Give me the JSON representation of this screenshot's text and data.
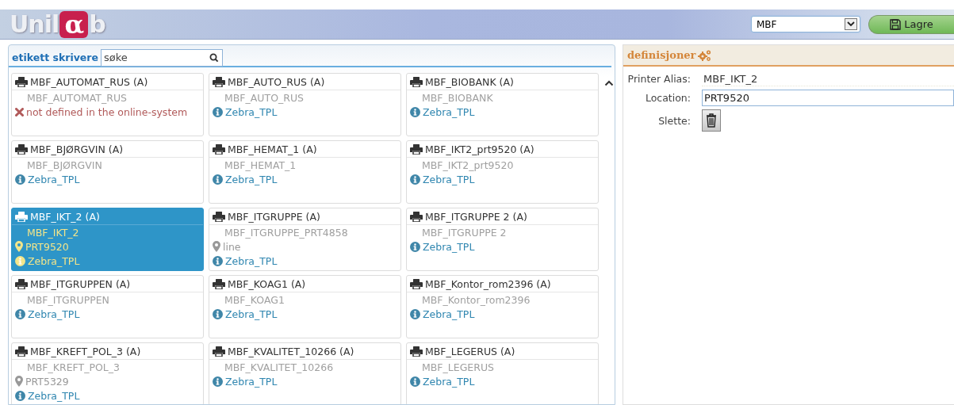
{
  "logo": {
    "before": "Unil",
    "mark": "α",
    "after": "b"
  },
  "toolbar": {
    "select_value": "MBF",
    "save_label": "Lagre"
  },
  "printer_panel": {
    "title": "etikett skrivere",
    "search": {
      "placeholder": "søke"
    },
    "printers": [
      {
        "name": "MBF_AUTOMAT_RUS (A)",
        "alias": "MBF_AUTOMAT_RUS",
        "selected": false,
        "lines": [
          {
            "kind": "error",
            "text": "not defined in the online-system"
          }
        ]
      },
      {
        "name": "MBF_AUTO_RUS (A)",
        "alias": "MBF_AUTO_RUS",
        "selected": false,
        "lines": [
          {
            "kind": "driver",
            "text": "Zebra_TPL"
          }
        ]
      },
      {
        "name": "MBF_BIOBANK (A)",
        "alias": "MBF_BIOBANK",
        "selected": false,
        "lines": [
          {
            "kind": "driver",
            "text": "Zebra_TPL"
          }
        ]
      },
      {
        "name": "MBF_BJØRGVIN (A)",
        "alias": "MBF_BJØRGVIN",
        "selected": false,
        "lines": [
          {
            "kind": "driver",
            "text": "Zebra_TPL"
          }
        ]
      },
      {
        "name": "MBF_HEMAT_1 (A)",
        "alias": "MBF_HEMAT_1",
        "selected": false,
        "lines": [
          {
            "kind": "driver",
            "text": "Zebra_TPL"
          }
        ]
      },
      {
        "name": "MBF_IKT2_prt9520 (A)",
        "alias": "MBF_IKT2_prt9520",
        "selected": false,
        "lines": [
          {
            "kind": "driver",
            "text": "Zebra_TPL"
          }
        ]
      },
      {
        "name": "MBF_IKT_2 (A)",
        "alias": "MBF_IKT_2",
        "selected": true,
        "lines": [
          {
            "kind": "location",
            "text": "PRT9520"
          },
          {
            "kind": "driver",
            "text": "Zebra_TPL"
          }
        ]
      },
      {
        "name": "MBF_ITGRUPPE (A)",
        "alias": "MBF_ITGRUPPE_PRT4858",
        "selected": false,
        "lines": [
          {
            "kind": "location",
            "text": "line"
          },
          {
            "kind": "driver",
            "text": "Zebra_TPL"
          }
        ]
      },
      {
        "name": "MBF_ITGRUPPE 2 (A)",
        "alias": "MBF_ITGRUPPE 2",
        "selected": false,
        "lines": [
          {
            "kind": "driver",
            "text": "Zebra_TPL"
          }
        ]
      },
      {
        "name": "MBF_ITGRUPPEN (A)",
        "alias": "MBF_ITGRUPPEN",
        "selected": false,
        "lines": [
          {
            "kind": "driver",
            "text": "Zebra_TPL"
          }
        ]
      },
      {
        "name": "MBF_KOAG1 (A)",
        "alias": "MBF_KOAG1",
        "selected": false,
        "lines": [
          {
            "kind": "driver",
            "text": "Zebra_TPL"
          }
        ]
      },
      {
        "name": "MBF_Kontor_rom2396 (A)",
        "alias": "MBF_Kontor_rom2396",
        "selected": false,
        "lines": [
          {
            "kind": "driver",
            "text": "Zebra_TPL"
          }
        ]
      },
      {
        "name": "MBF_KREFT_POL_3 (A)",
        "alias": "MBF_KREFT_POL_3",
        "selected": false,
        "lines": [
          {
            "kind": "location",
            "text": "PRT5329"
          },
          {
            "kind": "driver",
            "text": "Zebra_TPL"
          }
        ]
      },
      {
        "name": "MBF_KVALITET_10266 (A)",
        "alias": "MBF_KVALITET_10266",
        "selected": false,
        "lines": [
          {
            "kind": "driver",
            "text": "Zebra_TPL"
          }
        ]
      },
      {
        "name": "MBF_LEGERUS (A)",
        "alias": "MBF_LEGERUS",
        "selected": false,
        "lines": [
          {
            "kind": "driver",
            "text": "Zebra_TPL"
          }
        ]
      }
    ]
  },
  "definitions": {
    "title": "definisjoner",
    "fields": [
      {
        "kind": "text",
        "label": "Printer Alias:",
        "value": "MBF_IKT_2"
      },
      {
        "kind": "input",
        "label": "Location:",
        "value": "PRT9520"
      },
      {
        "kind": "delete",
        "label": "Slette:"
      }
    ]
  }
}
